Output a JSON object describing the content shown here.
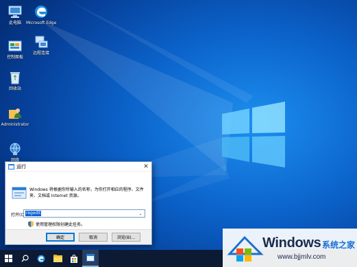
{
  "desktop": {
    "icons": [
      {
        "label": "此电脑",
        "icon": "computer-icon"
      },
      {
        "label": "Microsoft Edge",
        "icon": "edge-icon"
      },
      {
        "label": "控制面板",
        "icon": "control-panel-icon"
      },
      {
        "label": "远程连接",
        "icon": "network-icon"
      },
      {
        "label": "回收站",
        "icon": "recycle-bin-icon"
      },
      {
        "label": "Administrator",
        "icon": "user-folder-icon"
      },
      {
        "label": "网络",
        "icon": "network-globe-icon"
      }
    ]
  },
  "run_dialog": {
    "title": "运行",
    "description": "Windows 将根据你所输入的名称，为你打开相应的程序、文件夹、文档或 Internet 资源。",
    "open_label": "打开(O):",
    "open_value": "regedit",
    "admin_note": "使用管理权限创建此任务。",
    "buttons": {
      "ok": "确定",
      "cancel": "取消",
      "browse": "浏览(B)..."
    }
  },
  "taskbar": {
    "items": [
      "start-icon",
      "search-icon",
      "edge-icon",
      "file-explorer-icon",
      "store-icon",
      "run-icon"
    ]
  },
  "watermark": {
    "brand": "Windows",
    "cn": "系统之家",
    "url": "www.bjjmlv.com"
  },
  "colors": {
    "accent": "#0078d7",
    "taskbar": "#0c1a33",
    "desktop": "#0b62c9"
  }
}
